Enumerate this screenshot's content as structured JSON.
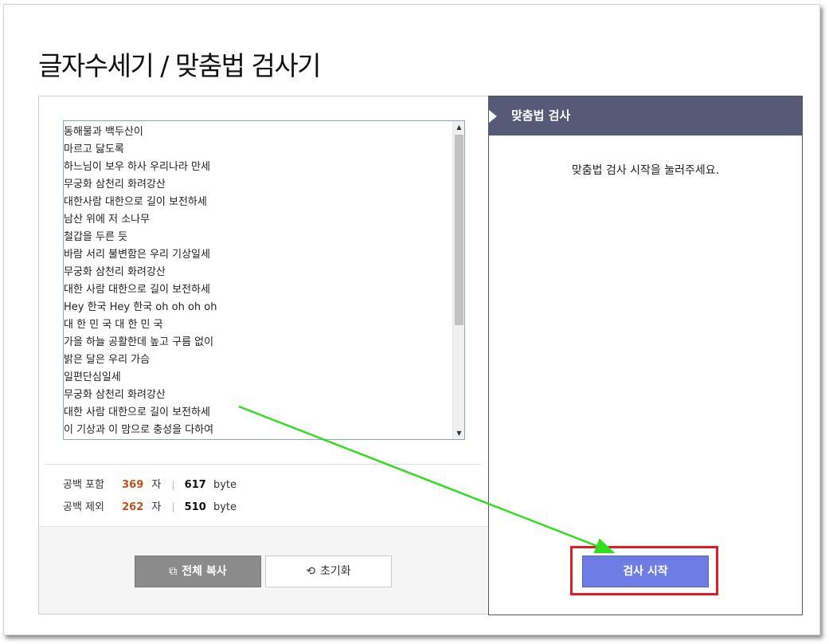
{
  "page": {
    "title": "글자수세기 / 맞춤법 검사기"
  },
  "editor": {
    "lines": [
      "동해물과 백두산이",
      "마르고 닳도록",
      "하느님이 보우 하사 우리나라 만세",
      "무궁화 삼천리 화려강산",
      "대한사람 대한으로 길이 보전하세",
      "남산 위에 저 소나무",
      "철갑을 두른 듯",
      "바람 서리 불변함은 우리 기상일세",
      "무궁화 삼천리 화려강산",
      "대한 사람 대한으로 길이 보전하세",
      "Hey 한국 Hey 한국 oh oh oh oh",
      "대 한 민 국 대 한 민 국",
      "가을 하늘 공활한데 높고 구름 없이",
      "밝은 달은 우리 가슴",
      "일편단심일세",
      "무궁화 삼천리 화려강산",
      "대한 사람 대한으로 길이 보전하세",
      "이 기상과 이 맘으로 충성을 다하여"
    ],
    "scroll_up_icon": "▲",
    "scroll_down_icon": "▼"
  },
  "stats": {
    "with_spaces": {
      "label": "공백 포함",
      "chars": "369",
      "char_unit": "자",
      "bytes": "617",
      "byte_unit": "byte"
    },
    "without_spaces": {
      "label": "공백 제외",
      "chars": "262",
      "char_unit": "자",
      "bytes": "510",
      "byte_unit": "byte"
    }
  },
  "buttons": {
    "copy_all": {
      "label": "전체 복사",
      "icon": "copy-icon",
      "glyph": "⧉"
    },
    "reset": {
      "label": "초기화",
      "icon": "refresh-icon",
      "glyph": "⟲"
    },
    "start_check": {
      "label": "검사 시작"
    }
  },
  "spellcheck": {
    "header": "맞춤법 검사",
    "message": "맞춤법 검사 시작을 눌러주세요."
  },
  "colors": {
    "accent_count": "#c0501c",
    "header_bg": "#565a77",
    "start_button": "#6e7de6",
    "annotation_box": "#e31b23",
    "annotation_arrow": "#33dd22"
  }
}
